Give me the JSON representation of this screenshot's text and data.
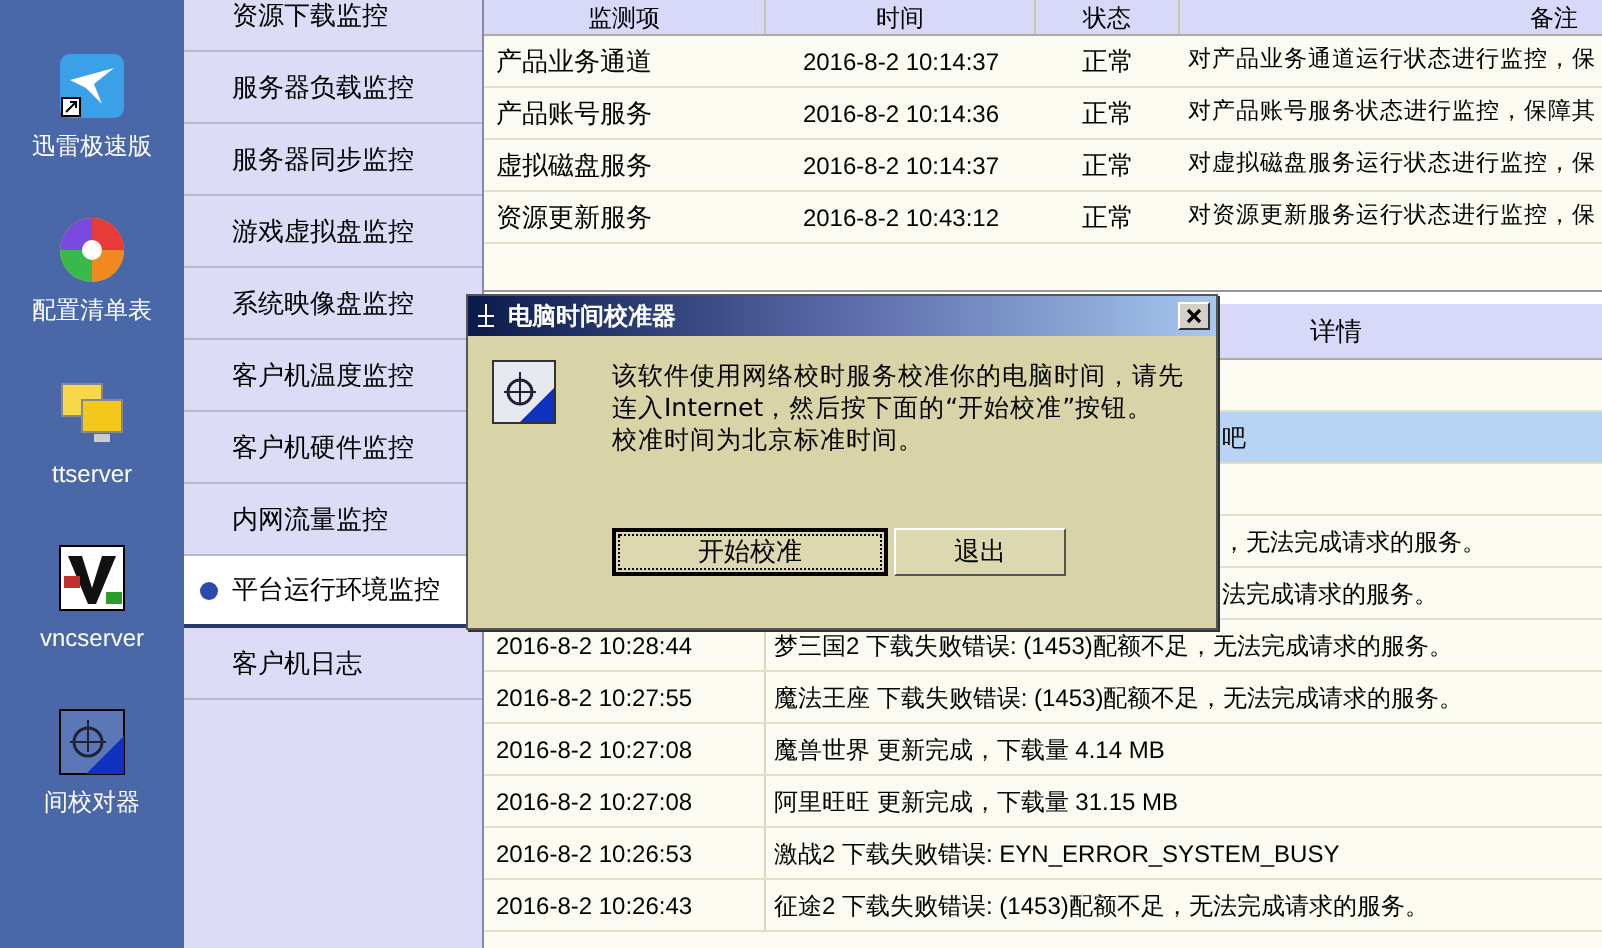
{
  "desktop_icons": [
    {
      "kind": "bird",
      "label": "迅雷极速版"
    },
    {
      "kind": "wheel",
      "label": "配置清单表"
    },
    {
      "kind": "monitors",
      "label": "ttserver"
    },
    {
      "kind": "vnc",
      "label": "vncserver"
    },
    {
      "kind": "clock",
      "label": "间校对器"
    }
  ],
  "sidebar": {
    "items": [
      {
        "label": "资源下载监控",
        "selected": false
      },
      {
        "label": "服务器负载监控",
        "selected": false
      },
      {
        "label": "服务器同步监控",
        "selected": false
      },
      {
        "label": "游戏虚拟盘监控",
        "selected": false
      },
      {
        "label": "系统映像盘监控",
        "selected": false
      },
      {
        "label": "客户机温度监控",
        "selected": false
      },
      {
        "label": "客户机硬件监控",
        "selected": false
      },
      {
        "label": "内网流量监控",
        "selected": false
      },
      {
        "label": "平台运行环境监控",
        "selected": true
      },
      {
        "label": "客户机日志",
        "selected": false
      }
    ]
  },
  "status_table": {
    "columns": [
      "监测项",
      "时间",
      "状态",
      "备注"
    ],
    "rows": [
      {
        "item": "产品业务通道",
        "time": "2016-8-2 10:14:37",
        "status": "正常",
        "note": "对产品业务通道运行状态进行监控，保"
      },
      {
        "item": "产品账号服务",
        "time": "2016-8-2 10:14:36",
        "status": "正常",
        "note": "对产品账号服务状态进行监控，保障其"
      },
      {
        "item": "虚拟磁盘服务",
        "time": "2016-8-2 10:14:37",
        "status": "正常",
        "note": "对虚拟磁盘服务运行状态进行监控，保"
      },
      {
        "item": "资源更新服务",
        "time": "2016-8-2 10:43:12",
        "status": "正常",
        "note": "对资源更新服务运行状态进行监控，保"
      }
    ]
  },
  "log_table": {
    "columns": [
      "详情"
    ],
    "rows": [
      {
        "kind": "covered",
        "selected": false
      },
      {
        "kind": "covered",
        "selected": true,
        "detail": "吧"
      },
      {
        "kind": "covered",
        "selected": false
      },
      {
        "kind": "covered",
        "selected": false,
        "detail": "，无法完成请求的服务。"
      },
      {
        "kind": "covered",
        "selected": false,
        "detail": "法完成请求的服务。"
      },
      {
        "kind": "full",
        "selected": false,
        "time": "2016-8-2 10:28:44",
        "detail": "梦三国2 下载失败错误: (1453)配额不足，无法完成请求的服务。"
      },
      {
        "kind": "full",
        "selected": false,
        "time": "2016-8-2 10:27:55",
        "detail": "魔法王座 下载失败错误: (1453)配额不足，无法完成请求的服务。"
      },
      {
        "kind": "full",
        "selected": false,
        "time": "2016-8-2 10:27:08",
        "detail": "魔兽世界 更新完成，下载量 4.14 MB"
      },
      {
        "kind": "full",
        "selected": false,
        "time": "2016-8-2 10:27:08",
        "detail": "阿里旺旺 更新完成，下载量 31.15 MB"
      },
      {
        "kind": "full",
        "selected": false,
        "time": "2016-8-2 10:26:53",
        "detail": "激战2 下载失败错误: EYN_ERROR_SYSTEM_BUSY"
      },
      {
        "kind": "full",
        "selected": false,
        "time": "2016-8-2 10:26:43",
        "detail": "征途2 下载失败错误: (1453)配额不足，无法完成请求的服务。"
      }
    ]
  },
  "dialog": {
    "title": "电脑时间校准器",
    "message": [
      "该软件使用网络校时服务校准你的电脑时间，请先",
      "连入Internet，然后按下面的“开始校准”按钮。",
      "校准时间为北京标准时间。"
    ],
    "buttons": [
      {
        "label": "开始校准",
        "focused": true
      },
      {
        "label": "退出",
        "focused": false
      }
    ]
  }
}
